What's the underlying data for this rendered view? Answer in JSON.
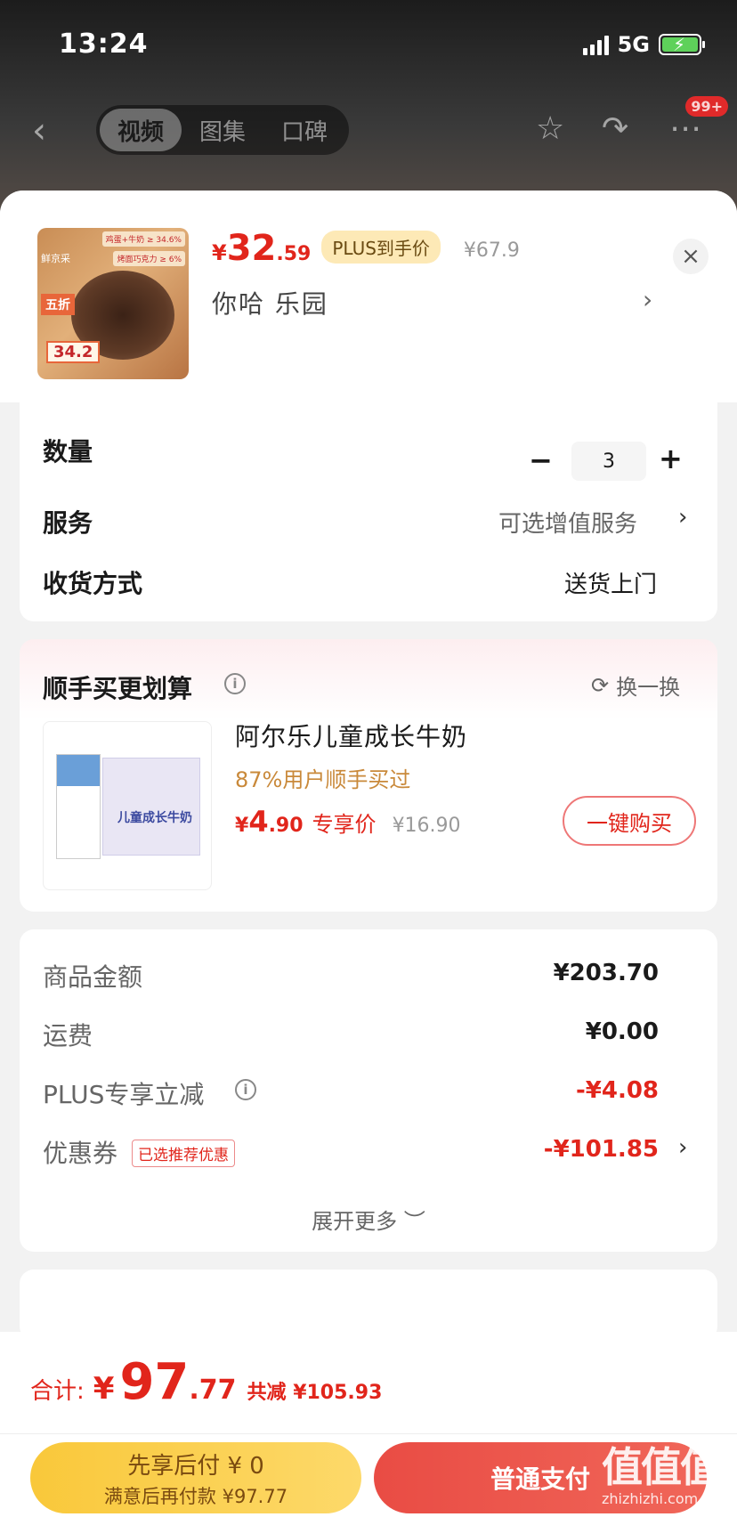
{
  "status": {
    "time": "13:24",
    "network": "5G"
  },
  "nav": {
    "tabs": [
      "视频",
      "图集",
      "口碑"
    ],
    "badge": "99+"
  },
  "product": {
    "thumb": {
      "brand": "鲜京采",
      "tag1": "鸡蛋+牛奶 ≥ 34.6%",
      "tag2": "烤面巧克力 ≥ 6%",
      "discount": "五折",
      "price": "34.2"
    },
    "price_symbol": "¥",
    "price_int": "32",
    "price_dec": ".59",
    "plus_tag": "PLUS到手价",
    "original_price": "¥67.9",
    "spec": "你哈  乐园",
    "close": "×"
  },
  "options": {
    "quantity_label": "数量",
    "quantity_value": "3",
    "minus": "−",
    "plus": "+",
    "service_label": "服务",
    "service_value": "可选增值服务",
    "delivery_label": "收货方式",
    "delivery_value": "送货上门"
  },
  "addon": {
    "title": "顺手买更划算",
    "refresh": "换一换",
    "product_name": "阿尔乐儿童成长牛奶",
    "subtitle": "87%用户顺手买过",
    "price_symbol": "¥",
    "price_int": "4",
    "price_dec": ".90",
    "price_label": "专享价",
    "original_price": "¥16.90",
    "buy_button": "一键购买",
    "box_label": "儿童成长牛奶"
  },
  "summary": {
    "goods_label": "商品金额",
    "goods_value": "¥203.70",
    "shipping_label": "运费",
    "shipping_value": "¥0.00",
    "plus_label": "PLUS专享立减",
    "plus_value": "-¥4.08",
    "coupon_label": "优惠券",
    "coupon_tag": "已选推荐优惠",
    "coupon_value": "-¥101.85",
    "expand": "展开更多 ︶"
  },
  "footer": {
    "total_label": "合计:",
    "total_symbol": "¥",
    "total_int": "97",
    "total_dec": ".77",
    "saved": "共减 ¥105.93",
    "pay_later_main": "先享后付 ¥ 0",
    "pay_later_sub": "满意后再付款 ¥97.77",
    "pay_normal": "普通支付"
  },
  "watermark": {
    "main": "值值值",
    "sub": "zhizhizhi.com"
  },
  "colors": {
    "accent": "#e1251b",
    "plus": "#fde9b6",
    "pay_later": "#f9c83a"
  }
}
